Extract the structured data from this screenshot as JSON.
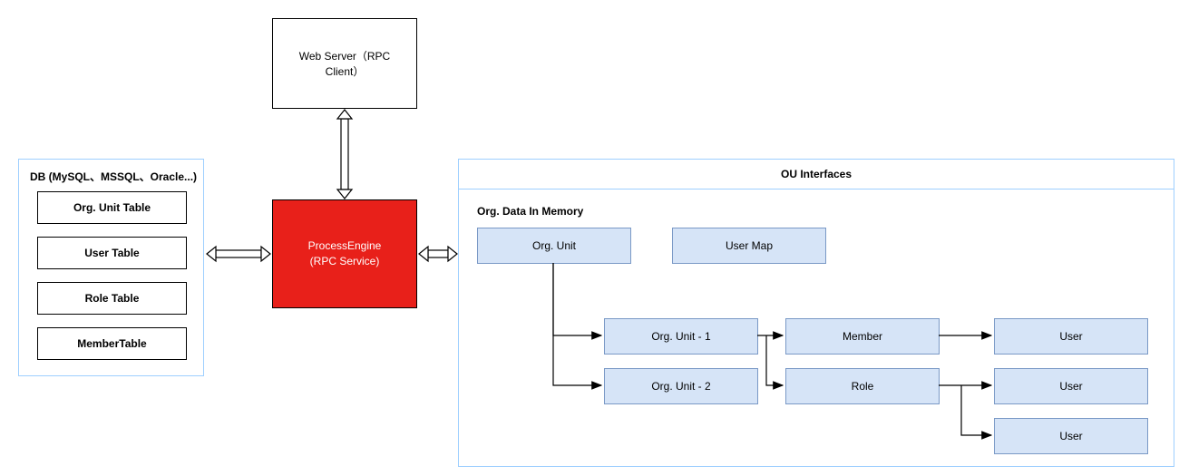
{
  "web_server": {
    "label": "Web Server（RPC Client）"
  },
  "process_engine": {
    "line1": "ProcessEngine",
    "line2": "(RPC Service)"
  },
  "db": {
    "title": "DB (MySQL、MSSQL、Oracle...)",
    "tables": {
      "org_unit": "Org. Unit Table",
      "user": "User Table",
      "role": "Role Table",
      "member": "MemberTable"
    }
  },
  "ou": {
    "title": "OU Interfaces",
    "subtitle": "Org. Data In Memory",
    "nodes": {
      "org_unit": "Org. Unit",
      "user_map": "User Map",
      "org_unit_1": "Org. Unit - 1",
      "org_unit_2": "Org. Unit - 2",
      "member": "Member",
      "role": "Role",
      "user_a": "User",
      "user_b": "User",
      "user_c": "User"
    }
  },
  "chart_data": {
    "type": "diagram",
    "title": "OU Interfaces architecture",
    "nodes": [
      {
        "id": "web_server",
        "label": "Web Server（RPC Client）"
      },
      {
        "id": "process_engine",
        "label": "ProcessEngine (RPC Service)"
      },
      {
        "id": "db",
        "label": "DB (MySQL、MSSQL、Oracle...)",
        "children": [
          "Org. Unit Table",
          "User Table",
          "Role Table",
          "MemberTable"
        ]
      },
      {
        "id": "ou_interfaces",
        "label": "OU Interfaces",
        "children": [
          "Org. Data In Memory"
        ]
      },
      {
        "id": "org_unit",
        "label": "Org. Unit"
      },
      {
        "id": "user_map",
        "label": "User Map"
      },
      {
        "id": "org_unit_1",
        "label": "Org. Unit - 1"
      },
      {
        "id": "org_unit_2",
        "label": "Org. Unit - 2"
      },
      {
        "id": "member",
        "label": "Member"
      },
      {
        "id": "role",
        "label": "Role"
      },
      {
        "id": "user_a",
        "label": "User"
      },
      {
        "id": "user_b",
        "label": "User"
      },
      {
        "id": "user_c",
        "label": "User"
      }
    ],
    "edges": [
      {
        "from": "web_server",
        "to": "process_engine",
        "style": "bi-open"
      },
      {
        "from": "db",
        "to": "process_engine",
        "style": "bi-open"
      },
      {
        "from": "process_engine",
        "to": "ou_interfaces",
        "style": "bi-open"
      },
      {
        "from": "org_unit",
        "to": "org_unit_1",
        "style": "arrow"
      },
      {
        "from": "org_unit",
        "to": "org_unit_2",
        "style": "arrow"
      },
      {
        "from": "org_unit_1",
        "to": "member",
        "style": "arrow"
      },
      {
        "from": "org_unit_1",
        "to": "role",
        "style": "arrow"
      },
      {
        "from": "member",
        "to": "user_a",
        "style": "arrow"
      },
      {
        "from": "role",
        "to": "user_b",
        "style": "arrow"
      },
      {
        "from": "role",
        "to": "user_c",
        "style": "arrow"
      }
    ]
  }
}
